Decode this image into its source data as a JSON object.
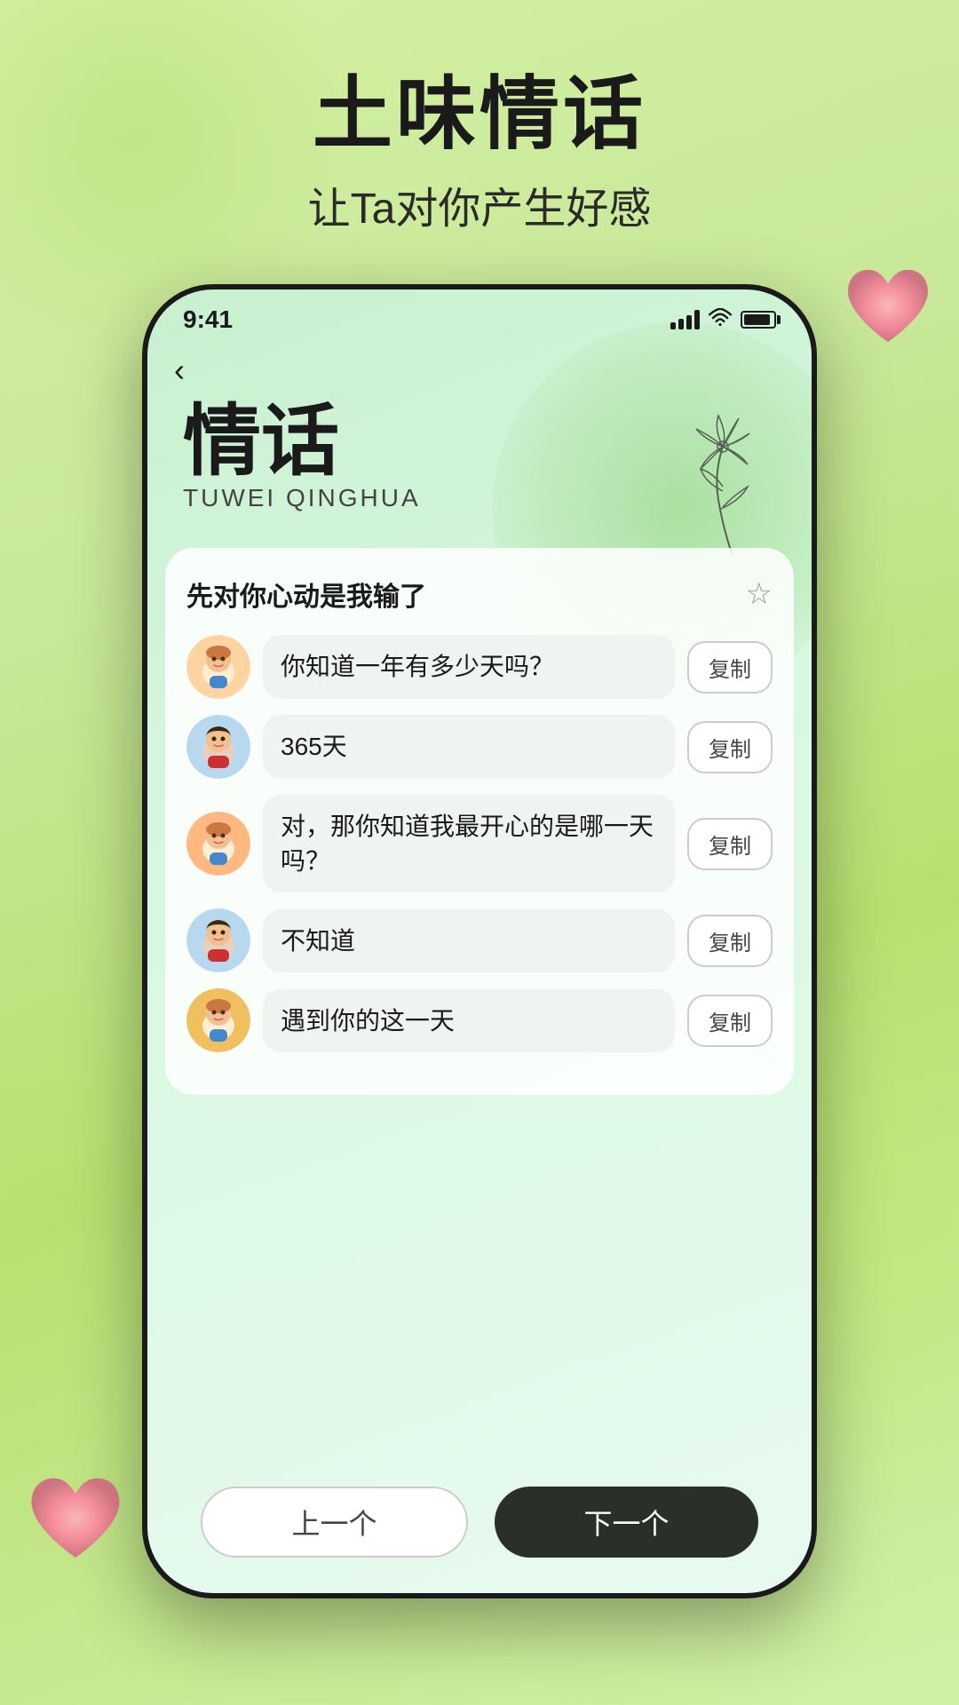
{
  "app": {
    "main_title": "土味情话",
    "sub_title": "让Ta对你产生好感"
  },
  "status_bar": {
    "time": "9:41",
    "signal_label": "signal",
    "wifi_label": "wifi",
    "battery_label": "battery"
  },
  "phone": {
    "back_icon": "‹",
    "sparkle_icon": "✦",
    "title_cn": "情话",
    "title_en": "TUWEI QINGHUA",
    "card_title": "先对你心动是我输了",
    "star_icon": "☆",
    "chat_items": [
      {
        "avatar_type": "girl",
        "text": "你知道一年有多少天吗？",
        "copy_label": "复制"
      },
      {
        "avatar_type": "boy",
        "text": "365天",
        "copy_label": "复制"
      },
      {
        "avatar_type": "girl",
        "text": "对，那你知道我最开心的是哪一天吗？",
        "copy_label": "复制"
      },
      {
        "avatar_type": "boy",
        "text": "不知道",
        "copy_label": "复制"
      },
      {
        "avatar_type": "girl",
        "text": "遇到你的这一天",
        "copy_label": "复制"
      }
    ],
    "btn_prev": "上一个",
    "btn_next": "下一个"
  }
}
